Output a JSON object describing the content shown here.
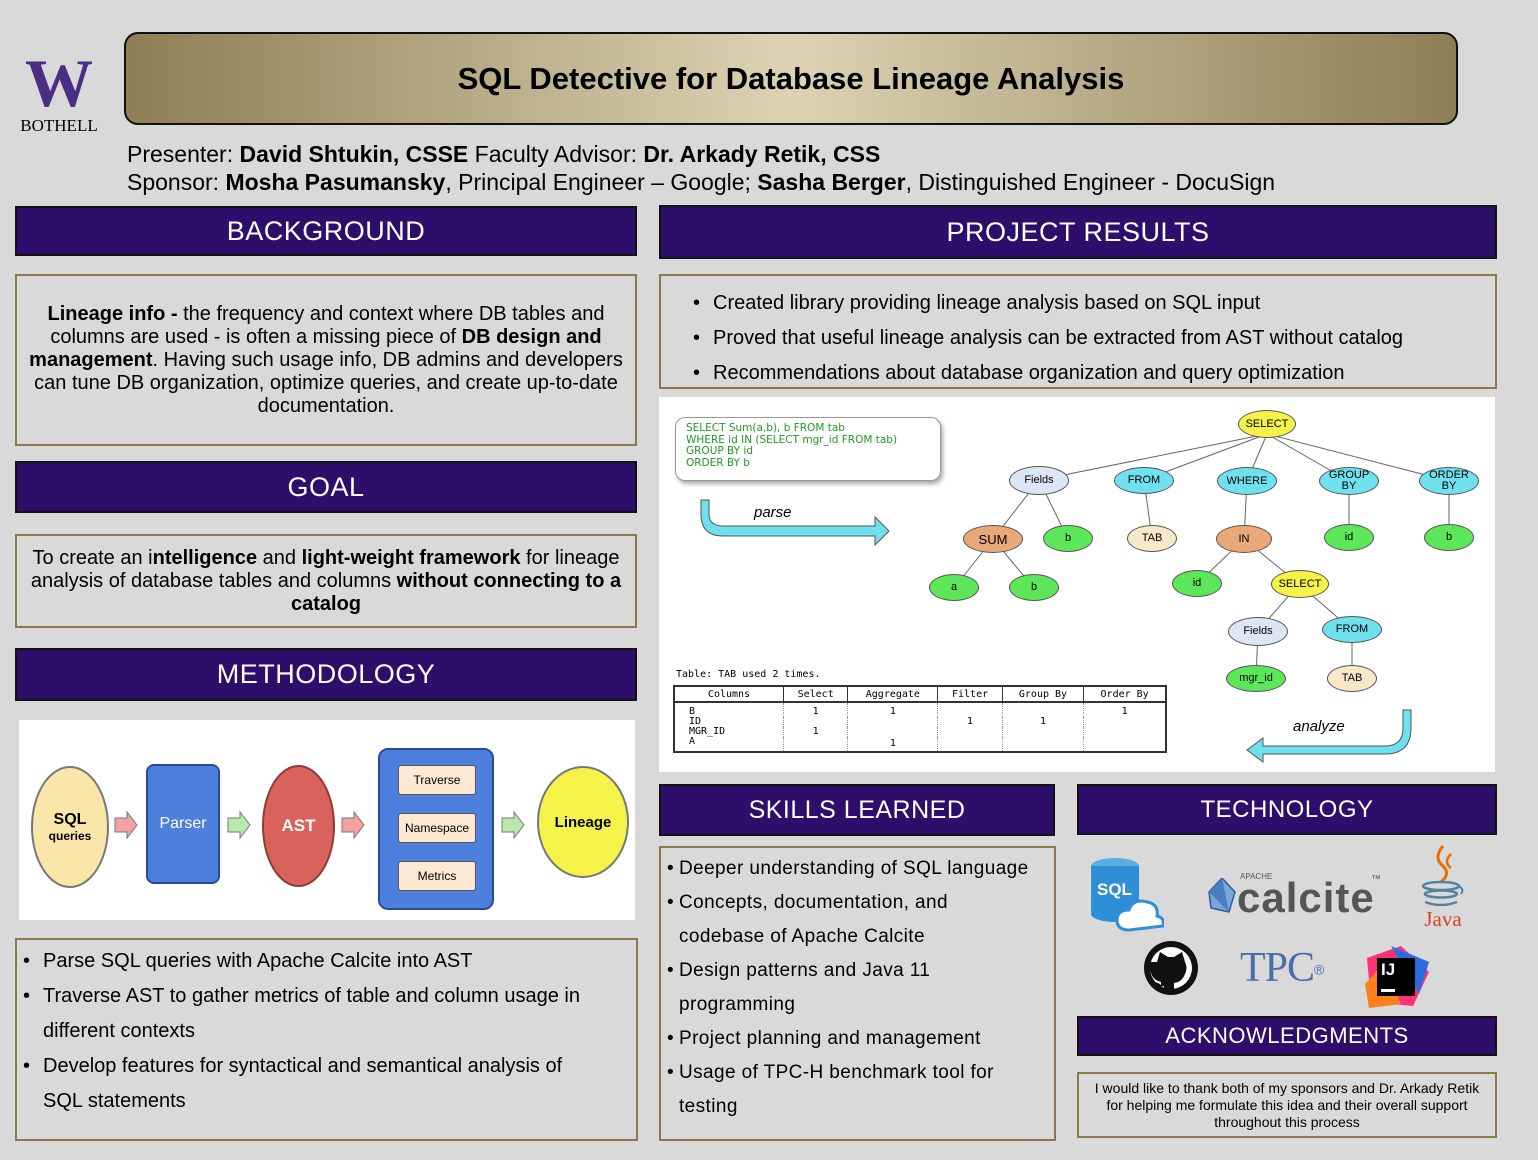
{
  "logo": {
    "letter": "W",
    "campus": "BOTHELL",
    "color": "#4b2e83"
  },
  "title": "SQL Detective for Database Lineage Analysis",
  "people": {
    "presenter_label": "Presenter: ",
    "presenter_name": "David Shtukin, CSSE",
    "advisor_label": " Faculty Advisor: ",
    "advisor_name": "Dr. Arkady Retik, CSS",
    "sponsor_label": "Sponsor: ",
    "sponsor1_name": "Mosha Pasumansky",
    "sponsor1_role": ", Principal Engineer – Google; ",
    "sponsor2_name": "Sasha Berger",
    "sponsor2_role": ", Distinguished Engineer - DocuSign"
  },
  "background": {
    "heading": "BACKGROUND",
    "b1": "Lineage info - ",
    "t1": " the frequency and context where DB tables and columns are used - is often a missing piece of ",
    "b2": "DB design and management",
    "t2": ". Having such usage info, DB admins and developers can tune DB organization, optimize queries, and create up-to-date documentation."
  },
  "goal": {
    "heading": "GOAL",
    "t1": "To create an i",
    "b1": "ntelligence",
    "t2": " and ",
    "b2": "light-weight framework",
    "t3": " for lineage analysis of database tables and columns ",
    "b3": "without connecting to a catalog"
  },
  "methodology": {
    "heading": "METHODOLOGY",
    "diagram": {
      "sql": "SQL",
      "queries": "queries",
      "parser": "Parser",
      "ast": "AST",
      "traverse": "Traverse",
      "namespace": "Namespace",
      "metrics": "Metrics",
      "lineage": "Lineage"
    },
    "bullets": [
      "Parse SQL queries with Apache Calcite into AST",
      "Traverse AST to gather metrics of table and column usage in different contexts",
      "Develop features for syntactical and semantical analysis of SQL statements"
    ]
  },
  "results": {
    "heading": "PROJECT RESULTS",
    "bullets": [
      "Created library providing lineage analysis based on SQL input",
      "Proved that useful lineage analysis can be extracted from AST without catalog",
      "Recommendations about database organization and query optimization"
    ],
    "sql_lines": [
      "SELECT Sum(a,b), b FROM tab",
      "WHERE id IN (SELECT mgr_id FROM tab)",
      "GROUP BY id",
      "ORDER BY b"
    ],
    "parse_label": "parse",
    "analyze_label": "analyze",
    "tree": {
      "select": "SELECT",
      "fields": "Fields",
      "from": "FROM",
      "where": "WHERE",
      "groupby": "GROUP BY",
      "orderby": "ORDER BY",
      "sum": "SUM",
      "b1": "b",
      "tab1": "TAB",
      "in": "IN",
      "id1": "id",
      "b2": "b",
      "a": "a",
      "b3": "b",
      "id2": "id",
      "select2": "SELECT",
      "fields2": "Fields",
      "from2": "FROM",
      "mgr_id": "mgr_id",
      "tab2": "TAB"
    },
    "table_caption": "Table: TAB used 2 times.",
    "table_headers": [
      "Columns",
      "Select",
      "Aggregate",
      "Filter",
      "Group By",
      "Order By"
    ],
    "table_rows": [
      [
        "B",
        "1",
        "1",
        "",
        "",
        "1"
      ],
      [
        "ID",
        "",
        "",
        "1",
        "1",
        ""
      ],
      [
        "MGR_ID",
        "1",
        "",
        "",
        "",
        ""
      ],
      [
        "A",
        "",
        "1",
        "",
        "",
        ""
      ]
    ]
  },
  "skills": {
    "heading": "SKILLS LEARNED",
    "bullets": [
      "Deeper understanding of SQL language",
      "Concepts, documentation, and codebase of Apache Calcite",
      "Design patterns and Java 11 programming",
      "Project planning and management",
      "Usage of TPC-H benchmark tool for testing"
    ]
  },
  "technology": {
    "heading": "TECHNOLOGY",
    "sql": "SQL",
    "calcite_apache": "APACHE",
    "calcite": "calcite",
    "tm": "™",
    "java": "Java",
    "tpc": "TPC",
    "reg": "®",
    "ij": "IJ"
  },
  "acknowledgments": {
    "heading": "ACKNOWLEDGMENTS",
    "text": "I would like to thank both of my sponsors and Dr. Arkady Retik for helping me formulate this idea and their overall support throughout this process"
  },
  "colors": {
    "header_bg": "#2e0e6b",
    "box_border": "#8a7a4a",
    "node_blue": "#dce6f5",
    "node_cyan": "#6ee0ee",
    "node_yellow": "#f5f34a",
    "node_green": "#5ee65a",
    "node_orange": "#e8a878",
    "node_beige": "#f7e8c8"
  }
}
